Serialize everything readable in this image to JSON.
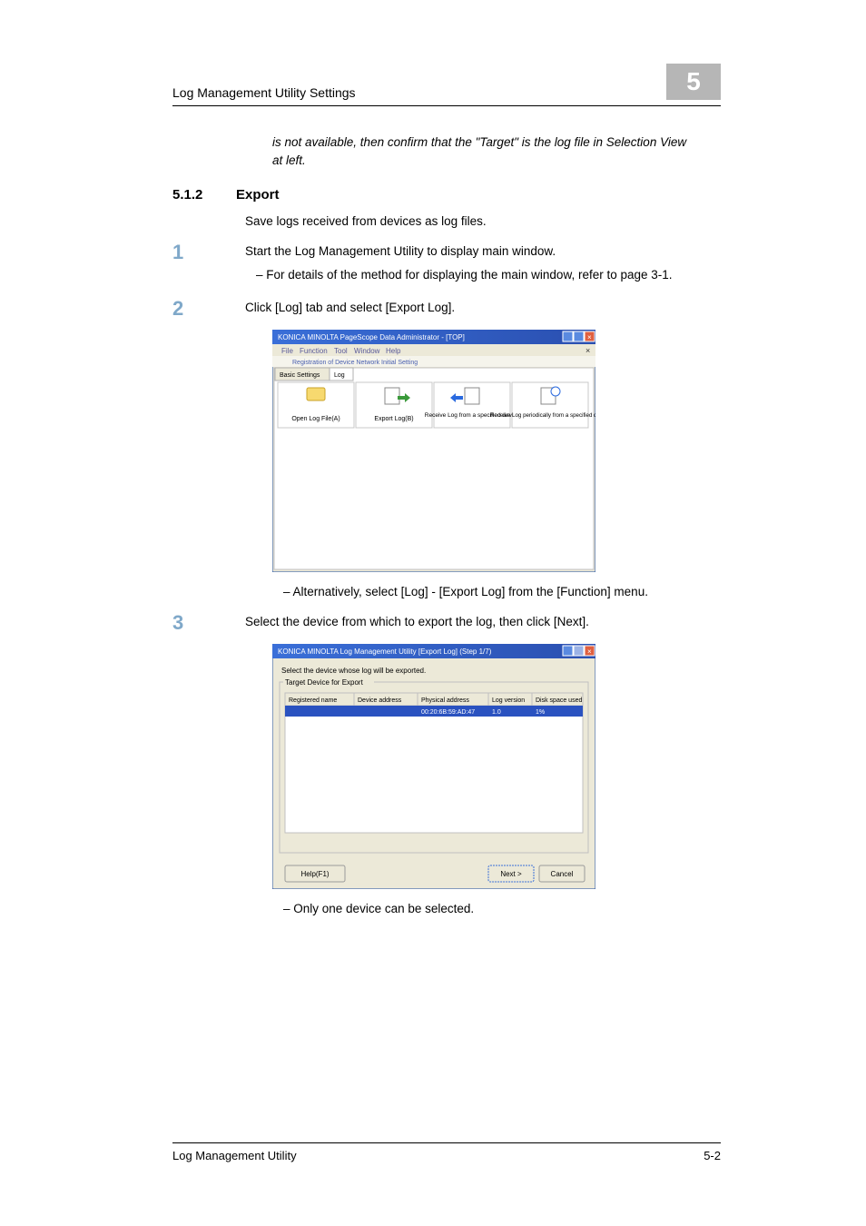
{
  "header": {
    "title": "Log Management Utility Settings",
    "chapter": "5"
  },
  "note": "is not available, then confirm that the \"Target\" is the log file in Selection View at left.",
  "section": {
    "num": "5.1.2",
    "title": "Export",
    "intro": "Save logs received from devices as log files."
  },
  "steps": {
    "s1": {
      "num": "1",
      "text": "Start the Log Management Utility to display main window.",
      "sub1": "For details of the method for displaying the main window, refer to page 3-1."
    },
    "s2": {
      "num": "2",
      "text": "Click [Log] tab and select [Export Log].",
      "sub1": "Alternatively, select [Log] - [Export Log] from the [Function] menu."
    },
    "s3": {
      "num": "3",
      "text": "Select the device from which to export the log, then click [Next].",
      "sub1": "Only one device can be selected."
    }
  },
  "screenshot1": {
    "title": "KONICA MINOLTA PageScope Data Administrator - [TOP]",
    "menus": [
      "File",
      "Function",
      "Tool",
      "Window",
      "Help"
    ],
    "toolbar_link": "Registration of Device    Network Initial Setting",
    "tabs": [
      "Basic Settings",
      "Log"
    ],
    "items": {
      "open": "Open Log File(A)",
      "export": "Export Log(B)",
      "receive": "Receive Log from a specified device",
      "periodic": "Receive Log periodically from a specified device"
    }
  },
  "screenshot2": {
    "title": "KONICA MINOLTA Log Management Utility [Export Log] (Step 1/7)",
    "prompt": "Select the device whose log will be exported.",
    "group": "Target Device for Export",
    "cols": [
      "Registered name",
      "Device address",
      "Physical address",
      "Log version",
      "Disk space used"
    ],
    "row": {
      "phys": "00:20:6B:59:AD:47",
      "ver": "1.0",
      "disk": "1%"
    },
    "help": "Help(F1)",
    "next": "Next >",
    "cancel": "Cancel"
  },
  "footer": {
    "left": "Log Management Utility",
    "right": "5-2"
  }
}
